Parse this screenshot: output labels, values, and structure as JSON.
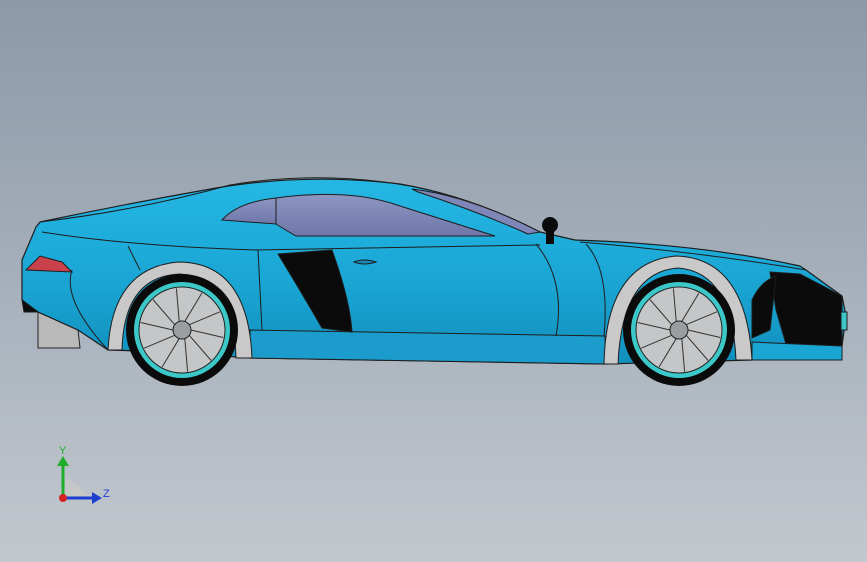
{
  "viewport": {
    "background_top": "#8d99a8",
    "background_bottom": "#c3c8ce"
  },
  "model": {
    "body_color": "#1aa6d4",
    "rim_color": "#3cc7c9",
    "glass_color": "#7f87b8",
    "trim_color": "#0b0b0b"
  },
  "triad": {
    "y_label": "Y",
    "z_label": "Z",
    "y_color": "#1fae2a",
    "z_color": "#1d3fd0",
    "x_color": "#d42020"
  }
}
